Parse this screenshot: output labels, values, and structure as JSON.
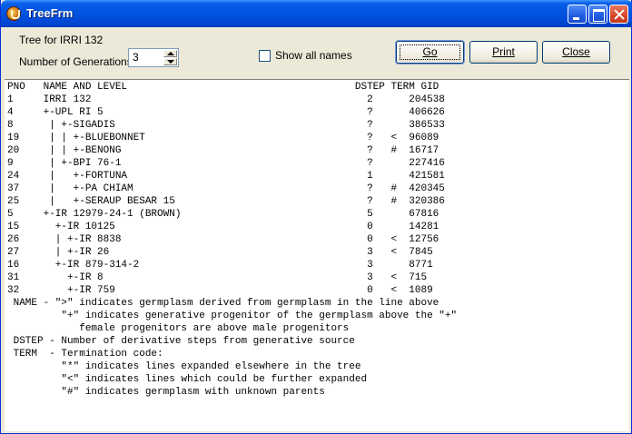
{
  "window": {
    "title": "TreeFrm"
  },
  "form": {
    "tree_label": "Tree for IRRI 132",
    "generations_label": "Number of Generations",
    "generations_value": "3",
    "show_all_label": "Show all names",
    "show_all_checked": false
  },
  "buttons": {
    "go": "Go",
    "print": "Print",
    "close": "Close"
  },
  "output_lines": [
    "PNO   NAME AND LEVEL                                      DSTEP TERM GID",
    "1     IRRI 132                                              2      204538",
    "4     +-UPL RI 5                                            ?      406626",
    "8      | +-SIGADIS                                          ?      386533",
    "19     | | +-BLUEBONNET                                     ?   <  96089",
    "20     | | +-BENONG                                         ?   #  16717",
    "9      | +-BPI 76-1                                         ?      227416",
    "24     |   +-FORTUNA                                        1      421581",
    "37     |   +-PA CHIAM                                       ?   #  420345",
    "25     |   +-SERAUP BESAR 15                                ?   #  320386",
    "5     +-IR 12979-24-1 (BROWN)                               5      67816",
    "15      +-IR 10125                                          0      14281",
    "26      | +-IR 8838                                         0   <  12756",
    "27      | +-IR 26                                           3   <  7845",
    "16      +-IR 879-314-2                                      3      8771",
    "31        +-IR 8                                            3   <  715",
    "32        +-IR 759                                          0   <  1089",
    " NAME - \">\" indicates germplasm derived from germplasm in the line above",
    "         \"+\" indicates generative progenitor of the germplasm above the \"+\"",
    "            female progenitors are above male progenitors",
    " DSTEP - Number of derivative steps from generative source",
    " TERM  - Termination code:",
    "         \"*\" indicates lines expanded elsewhere in the tree",
    "         \"<\" indicates lines which could be further expanded",
    "         \"#\" indicates germplasm with unknown parents"
  ]
}
